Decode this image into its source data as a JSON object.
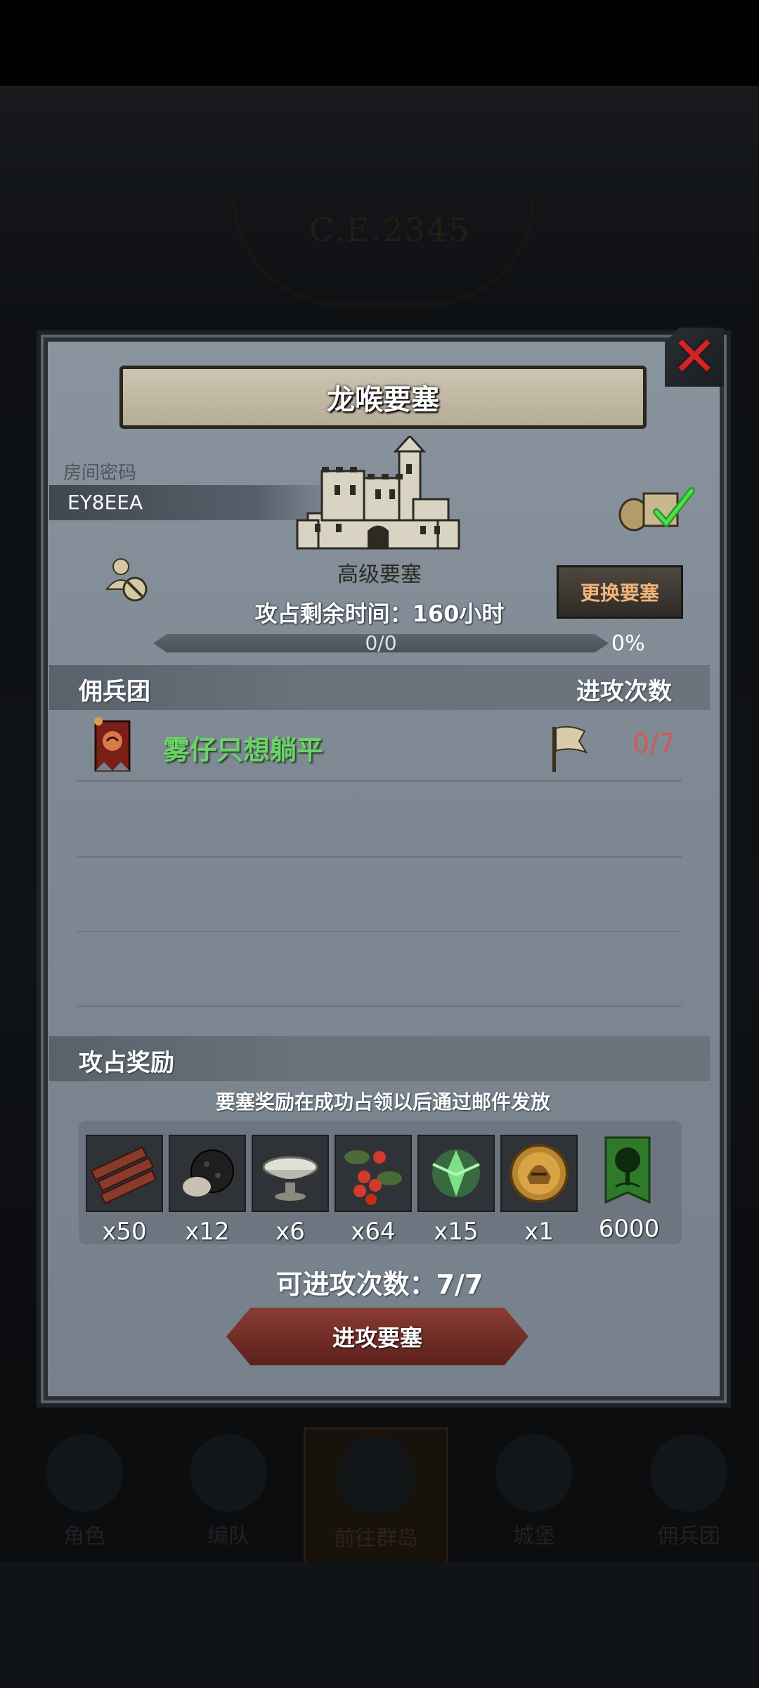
{
  "background": {
    "era_text": "C.E.2345"
  },
  "bottom_nav": [
    {
      "label": "角色"
    },
    {
      "label": "编队"
    },
    {
      "label": "前往群岛"
    },
    {
      "label": "城堡"
    },
    {
      "label": "佣兵团"
    }
  ],
  "dialog": {
    "title": "龙喉要塞",
    "room_label": "房间密码",
    "room_code": "EY8EEA",
    "fortress_type": "高级要塞",
    "change_button": "更换要塞",
    "time_label": "攻占剩余时间：",
    "time_value": "160",
    "time_unit": "小时",
    "progress_text": "0/0",
    "progress_percent": "0%",
    "progress_fraction": 0,
    "mercenary_header": "佣兵团",
    "attacks_header": "进攻次数",
    "guilds": [
      {
        "name": "雾仔只想躺平",
        "attacks": "0/7"
      }
    ],
    "rewards_header": "攻占奖励",
    "rewards_note": "要塞奖励在成功占领以后通过邮件发放",
    "rewards": [
      {
        "icon": "wood-planks-icon",
        "qty": "x50"
      },
      {
        "icon": "truffle-icon",
        "qty": "x12"
      },
      {
        "icon": "silver-bowl-icon",
        "qty": "x6"
      },
      {
        "icon": "berries-icon",
        "qty": "x64"
      },
      {
        "icon": "green-spirit-icon",
        "qty": "x15"
      },
      {
        "icon": "gold-helmet-medal-icon",
        "qty": "x1"
      },
      {
        "icon": "tree-banner-icon",
        "qty": "6000"
      }
    ],
    "available_attacks": "可进攻次数：7/7",
    "attack_button": "进攻要塞"
  },
  "colors": {
    "guild_name": "#6cd36c",
    "attack_count": "#d05a55",
    "change_button_text": "#f3b47a",
    "close_icon": "#d32323"
  }
}
